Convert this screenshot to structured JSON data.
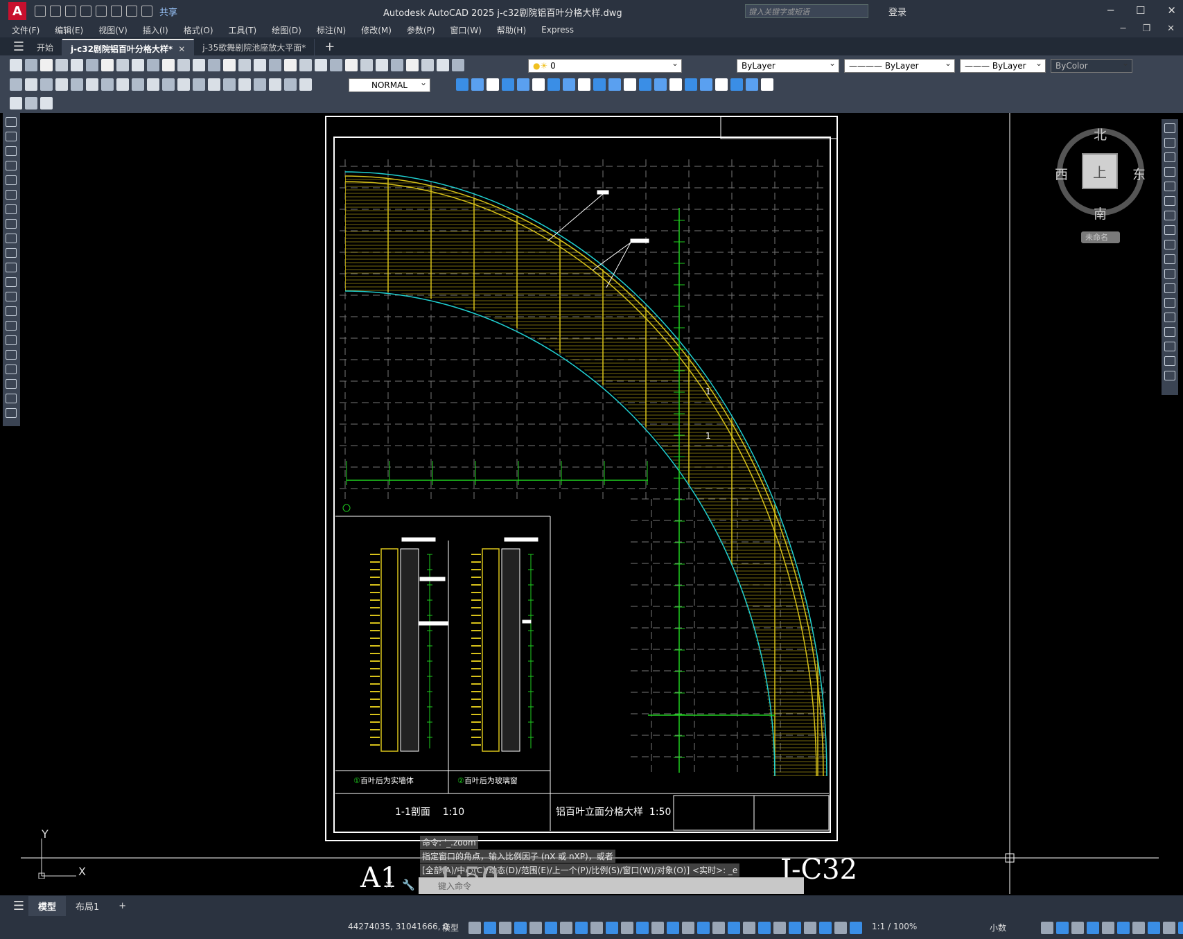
{
  "app": {
    "title": "Autodesk AutoCAD 2025    j-c32剧院铝百叶分格大样.dwg",
    "logo": "A",
    "share_label": "共享",
    "search_placeholder": "键入关键字或短语",
    "login_label": "登录"
  },
  "menu": [
    "文件(F)",
    "编辑(E)",
    "视图(V)",
    "插入(I)",
    "格式(O)",
    "工具(T)",
    "绘图(D)",
    "标注(N)",
    "修改(M)",
    "参数(P)",
    "窗口(W)",
    "帮助(H)",
    "Express"
  ],
  "tabs": [
    {
      "label": "开始",
      "active": false
    },
    {
      "label": "j-c32剧院铝百叶分格大样*",
      "active": true,
      "closable": true
    },
    {
      "label": "j-35歌舞剧院池座放大平面*",
      "active": false
    }
  ],
  "toolbar": {
    "layer_value": "0",
    "color_value": "ByLayer",
    "linetype_value": "ByLayer",
    "lineweight_value": "ByLayer",
    "plotstyle_value": "ByColor",
    "textstyle_value": "NORMAL"
  },
  "viewcube": {
    "north": "北",
    "south": "南",
    "east": "东",
    "west": "西",
    "top": "上",
    "ucs_label": "未命名"
  },
  "drawing": {
    "section_title": "1-1剖面",
    "section_scale": "1:10",
    "elev_title": "铝百叶立面分格大样",
    "elev_scale": "1:50",
    "detail1": "百叶后为实墙体",
    "detail2": "百叶后为玻璃窗",
    "detail1_num": "1",
    "detail2_num": "2",
    "sheet_size": "A1",
    "sheet_scale": "1:50",
    "sheet_number": "J-C32",
    "section_mark": "1"
  },
  "command": {
    "line1": "命令: '_.zoom",
    "line2": "指定窗口的角点，输入比例因子 (nX 或 nXP)，或者",
    "line3": "[全部(A)/中心(C)/动态(D)/范围(E)/上一个(P)/比例(S)/窗口(W)/对象(O)] <实时>: _e",
    "input_placeholder": "键入命令"
  },
  "layout_tabs": [
    {
      "label": "模型",
      "active": true
    },
    {
      "label": "布局1",
      "active": false
    }
  ],
  "status": {
    "coords": "44274035, 31041666, 0",
    "space": "模型",
    "annoscale": "1:1 / 100%",
    "units": "小数"
  },
  "ucs": {
    "x": "X",
    "y": "Y"
  },
  "colors": {
    "yellow": "#d8c21a",
    "green": "#1fd01f",
    "cyan": "#20d0d0",
    "white": "#ffffff",
    "gridgray": "#777777"
  }
}
